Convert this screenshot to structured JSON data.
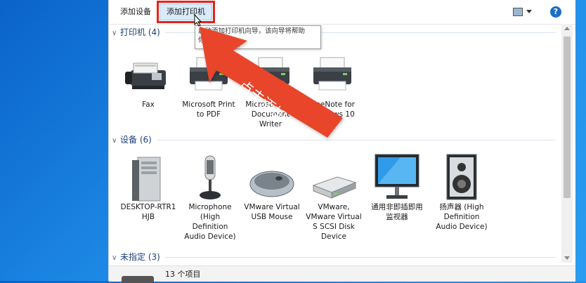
{
  "toolbar": {
    "add_device": "添加设备",
    "add_printer": "添加打印机",
    "help": "?"
  },
  "tooltip": "启动添加打印机向导，该向导将帮助你...",
  "sections": {
    "printers": {
      "title": "打印机 (4)"
    },
    "devices": {
      "title": "设备 (6)"
    },
    "unspecified": {
      "title": "未指定 (3)"
    }
  },
  "printers": [
    {
      "label": "Fax",
      "icon": "fax-icon"
    },
    {
      "label": "Microsoft Print to PDF",
      "icon": "printer-icon"
    },
    {
      "label": "Microsoft XPS Document Writer",
      "icon": "printer-icon"
    },
    {
      "label": "OneNote for Windows 10",
      "icon": "printer-icon"
    }
  ],
  "devices": [
    {
      "label": "DESKTOP-RTR1 HJB",
      "icon": "computer-tower-icon"
    },
    {
      "label": "Microphone (High Definition Audio Device)",
      "icon": "microphone-icon"
    },
    {
      "label": "VMware Virtual USB Mouse",
      "icon": "mouse-icon"
    },
    {
      "label": "VMware, VMware Virtual S SCSI Disk Device",
      "icon": "disk-drive-icon"
    },
    {
      "label": "通用非即插即用监视器",
      "icon": "monitor-icon"
    },
    {
      "label": "扬声器 (High Definition Audio Device)",
      "icon": "speaker-icon"
    }
  ],
  "annotation": {
    "text": "点击添加",
    "color": "#e8452c"
  },
  "status": {
    "count": "13 个项目"
  }
}
